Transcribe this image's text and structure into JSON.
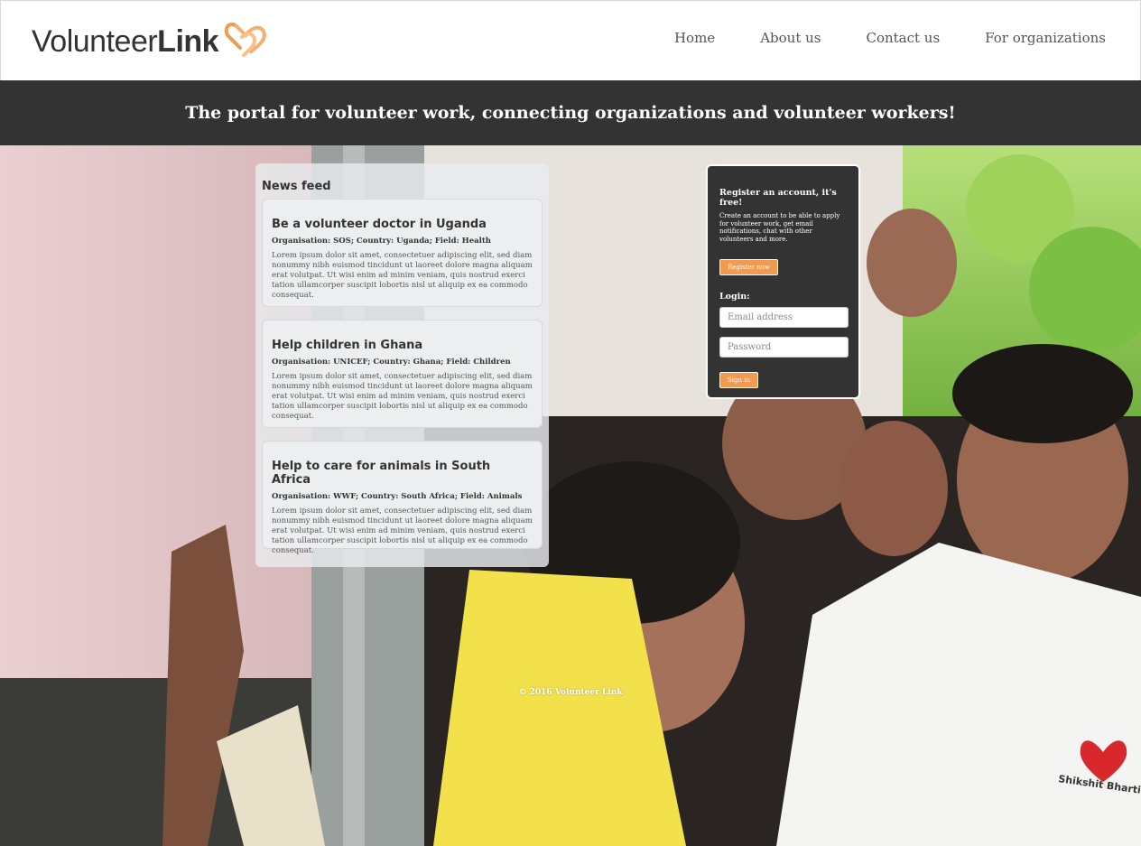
{
  "header": {
    "logo_text_light": "Volunteer",
    "logo_text_bold": "Link",
    "nav": [
      "Home",
      "About us",
      "Contact us",
      "For organizations"
    ]
  },
  "banner": {
    "tagline": "The portal for volunteer work, connecting organizations and volunteer workers!"
  },
  "news": {
    "title": "News feed",
    "items": [
      {
        "title": "Be a volunteer doctor in Uganda",
        "meta": "Organisation: SOS; Country: Uganda; Field: Health",
        "body": "Lorem ipsum dolor sit amet, consectetuer adipiscing elit, sed diam nonummy nibh euismod tincidunt ut laoreet dolore magna aliquam erat volutpat. Ut wisi enim ad minim veniam, quis nostrud exerci tation ullamcorper suscipit lobortis nisl ut aliquip ex ea commodo consequat."
      },
      {
        "title": "Help children in Ghana",
        "meta": "Organisation: UNICEF; Country: Ghana; Field: Children",
        "body": "Lorem ipsum dolor sit amet, consectetuer adipiscing elit, sed diam nonummy nibh euismod tincidunt ut laoreet dolore magna aliquam erat volutpat. Ut wisi enim ad minim veniam, quis nostrud exerci tation ullamcorper suscipit lobortis nisl ut aliquip ex ea commodo consequat."
      },
      {
        "title": "Help to care for animals in South Africa",
        "meta": "Organisation: WWF; Country: South Africa; Field: Animals",
        "body": "Lorem ipsum dolor sit amet, consectetuer adipiscing elit, sed diam nonummy nibh euismod tincidunt ut laoreet dolore magna aliquam erat volutpat. Ut wisi enim ad minim veniam, quis nostrud exerci tation ullamcorper suscipit lobortis nisl ut aliquip ex ea commodo consequat."
      }
    ]
  },
  "register": {
    "heading": "Register an account, it's free!",
    "description": "Create an account to be able to apply for volunteer work, get email notifications, chat with other volunteers and more.",
    "button": "Register now"
  },
  "login": {
    "label": "Login:",
    "email_placeholder": "Email address",
    "password_placeholder": "Password",
    "button": "Sign in"
  },
  "footer": {
    "text": "© 2016 Volunteer Link"
  },
  "hero": {
    "shirt_text": "Shikshit Bhartiya"
  },
  "colors": {
    "accent": "#f29a4e",
    "dark": "#333333"
  }
}
